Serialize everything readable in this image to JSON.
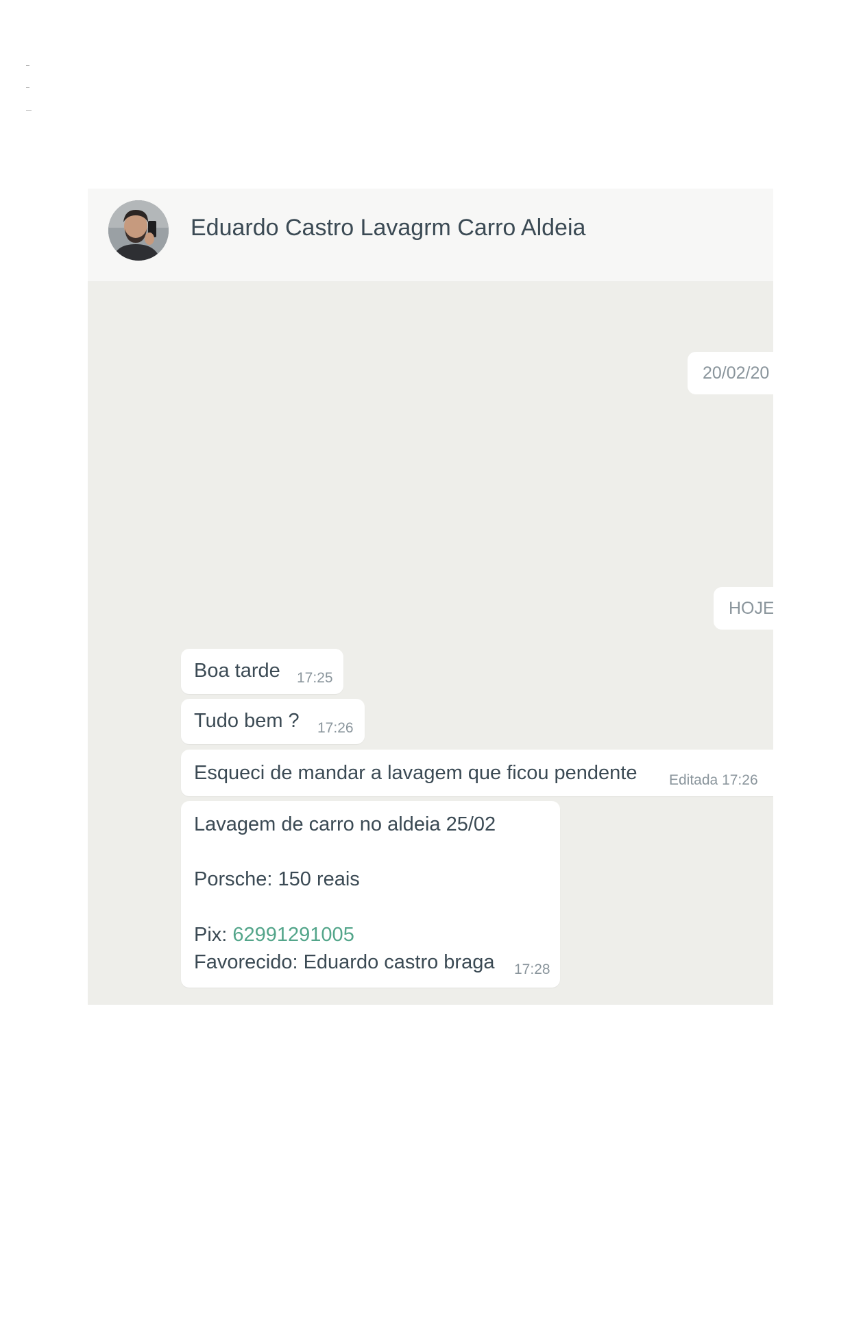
{
  "header": {
    "contact_name": "Eduardo Castro Lavagrm Carro Aldeia",
    "avatar": "avatar-photo"
  },
  "date_chips": {
    "earlier": "20/02/20",
    "today": "HOJE"
  },
  "messages": [
    {
      "text": "Boa tarde",
      "time": "17:25"
    },
    {
      "text": "Tudo bem ?",
      "time": "17:26"
    },
    {
      "text": "Esqueci de mandar a lavagem que ficou pendente",
      "edited": "Editada",
      "time": "17:26"
    },
    {
      "line1": "Lavagem de carro no aldeia 25/02",
      "line2": "Porsche: 150 reais",
      "pix_label": "Pix: ",
      "pix_number": "62991291005",
      "line4": "Favorecido: Eduardo castro braga",
      "time": "17:28"
    }
  ],
  "colors": {
    "chat_background": "#eeeeea",
    "bubble": "#ffffff",
    "link": "#53a58a",
    "text": "#3b4a54",
    "meta": "#8a959c"
  }
}
